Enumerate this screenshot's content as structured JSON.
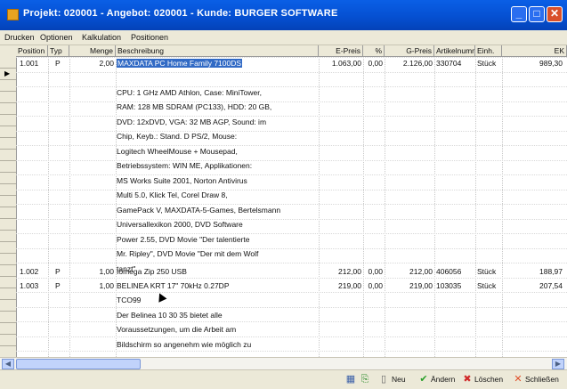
{
  "window": {
    "title": "Projekt: 020001 - Angebot: 020001 - Kunde: BURGER SOFTWARE",
    "minimize": "_",
    "maximize": "□",
    "close": "✕"
  },
  "menu": [
    "Drucken",
    "Optionen",
    "Kalkulation",
    "Positionen"
  ],
  "columns": [
    "Position",
    "Typ",
    "Menge",
    "Beschreibung",
    "E-Preis",
    "%",
    "G-Preis",
    "Artikelnumm",
    "Einh.",
    "EK"
  ],
  "rows": [
    {
      "position": "1.001",
      "typ": "P",
      "menge": "2,00",
      "description_title": "MAXDATA PC Home Family 7100DS",
      "description_lines": [
        "",
        "CPU: 1 GHz AMD Athlon, Case: MiniTower,",
        "RAM: 128 MB SDRAM (PC133), HDD: 20 GB,",
        "DVD: 12xDVD, VGA: 32 MB AGP, Sound: im",
        "Chip, Keyb.: Stand. D PS/2, Mouse:",
        "Logitech WheelMouse + Mousepad,",
        "Betriebssystem: WIN ME, Applikationen:",
        "MS Works Suite 2001, Norton Antivirus",
        "Multi 5.0, Klick Tel, Corel Draw 8,",
        "GamePack V, MAXDATA-5-Games, Bertelsmann",
        "Universallexikon 2000, DVD Software",
        "Power 2.55, DVD Movie \"Der talentierte",
        "Mr. Ripley\", DVD Movie \"Der mit dem Wolf",
        "tanzt\""
      ],
      "epreis": "1.063,00",
      "pct": "0,00",
      "gpreis": "2.126,00",
      "artikel": "330704",
      "einh": "Stück",
      "ek": "989,30"
    },
    {
      "position": "1.002",
      "typ": "P",
      "menge": "1,00",
      "description_title": "Iomega Zip 250 USB",
      "description_lines": [],
      "epreis": "212,00",
      "pct": "0,00",
      "gpreis": "212,00",
      "artikel": "406056",
      "einh": "Stück",
      "ek": "188,97"
    },
    {
      "position": "1.003",
      "typ": "P",
      "menge": "1,00",
      "description_title": "BELINEA KRT 17\" 70kHz 0.27DP",
      "description_lines": [
        "TCO99",
        "Der Belinea 10 30 35 bietet alle",
        "Voraussetzungen, um die Arbeit am",
        "Bildschirm so angenehm wie möglich zu"
      ],
      "epreis": "219,00",
      "pct": "0,00",
      "gpreis": "219,00",
      "artikel": "103035",
      "einh": "Stück",
      "ek": "207,54"
    }
  ],
  "toolbar": {
    "neu": "Neu",
    "aendern": "Ändern",
    "loeschen": "Löschen",
    "schliessen": "Schließen"
  }
}
